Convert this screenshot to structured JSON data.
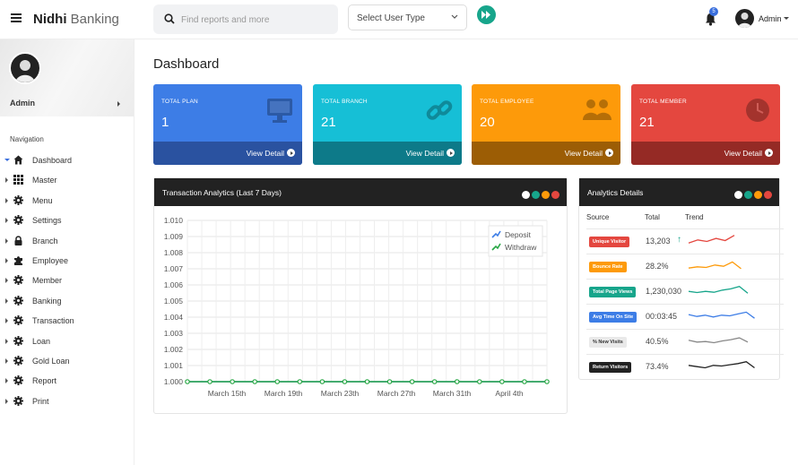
{
  "topbar": {
    "brand_bold": "Nidhi",
    "brand_light": "Banking",
    "search_placeholder": "Find reports and more",
    "user_type_label": "Select User Type",
    "notification_count": "5",
    "username": "Admin"
  },
  "sidebar": {
    "username": "Admin",
    "nav_heading": "Navigation",
    "items": [
      {
        "label": "Dashboard",
        "icon": "home-icon",
        "active": true
      },
      {
        "label": "Master",
        "icon": "grid-icon"
      },
      {
        "label": "Menu",
        "icon": "gear-icon"
      },
      {
        "label": "Settings",
        "icon": "gear-icon"
      },
      {
        "label": "Branch",
        "icon": "lock-icon"
      },
      {
        "label": "Employee",
        "icon": "puzzle-icon"
      },
      {
        "label": "Member",
        "icon": "gear-icon"
      },
      {
        "label": "Banking",
        "icon": "gear-icon"
      },
      {
        "label": "Transaction",
        "icon": "gear-icon"
      },
      {
        "label": "Loan",
        "icon": "gear-icon"
      },
      {
        "label": "Gold Loan",
        "icon": "gear-icon"
      },
      {
        "label": "Report",
        "icon": "gear-icon"
      },
      {
        "label": "Print",
        "icon": "gear-icon"
      }
    ]
  },
  "page_title": "Dashboard",
  "stats": [
    {
      "label": "TOTAL PLAN",
      "value": "1",
      "link": "View Detail",
      "icon": "monitor-icon",
      "color": "#3d7de6",
      "foot_color": "#2a52a0"
    },
    {
      "label": "TOTAL BRANCH",
      "value": "21",
      "link": "View Detail",
      "icon": "link-icon",
      "color": "#16bfd6",
      "foot_color": "#0d7a89"
    },
    {
      "label": "TOTAL EMPLOYEE",
      "value": "20",
      "link": "View Detail",
      "icon": "users-icon",
      "color": "#fd9a0a",
      "foot_color": "#9c5d05"
    },
    {
      "label": "TOTAL MEMBER",
      "value": "21",
      "link": "View Detail",
      "icon": "clock-icon",
      "color": "#e4473f",
      "foot_color": "#952a25"
    }
  ],
  "transaction_panel": {
    "title": "Transaction Analytics (Last 7 Days)"
  },
  "analytics_panel": {
    "title": "Analytics Details",
    "headers": [
      "Source",
      "Total",
      "Trend"
    ],
    "rows": [
      {
        "source": "Unique Visitor",
        "total": "13,203",
        "up": true,
        "color": "#e4473f",
        "text_color": "#ffffff",
        "trend": [
          2,
          3,
          2.5,
          3.5,
          2.8,
          4.5
        ]
      },
      {
        "source": "Bounce Rate",
        "total": "28.2%",
        "color": "#fd9a0a",
        "text_color": "#ffffff",
        "trend": [
          2,
          2.4,
          2.2,
          3,
          2.6,
          4,
          1.8
        ]
      },
      {
        "source": "Total Page Views",
        "total": "1,230,030",
        "color": "#17a58b",
        "text_color": "#ffffff",
        "trend": [
          2.6,
          2.2,
          2.6,
          2.3,
          3,
          3.4,
          4.2,
          2
        ]
      },
      {
        "source": "Avg Time On Site",
        "total": "00:03:45",
        "color": "#3d7de6",
        "text_color": "#ffffff",
        "trend": [
          3.2,
          2.6,
          3,
          2.4,
          3,
          2.8,
          3.4,
          4,
          2
        ]
      },
      {
        "source": "% New Visits",
        "total": "40.5%",
        "color": "#e9e9e9",
        "text_color": "#333333",
        "trend": [
          3,
          2.4,
          2.6,
          2.2,
          2.8,
          3.2,
          3.8,
          2.4
        ]
      },
      {
        "source": "Return Visitors",
        "total": "73.4%",
        "color": "#222222",
        "text_color": "#ffffff",
        "trend": [
          3,
          2.6,
          2.2,
          3,
          2.8,
          3.2,
          3.6,
          4.2,
          2.2
        ]
      }
    ]
  },
  "chart_data": {
    "type": "line",
    "title": "Transaction Analytics (Last 7 Days)",
    "xlabel": "",
    "ylabel": "",
    "x_tick_labels": [
      "March 15th",
      "March 19th",
      "March 23th",
      "March 27th",
      "March 31th",
      "April 4th"
    ],
    "yticks": [
      "1.000",
      "1.001",
      "1.002",
      "1.003",
      "1.004",
      "1.005",
      "1.006",
      "1.007",
      "1.008",
      "1.009",
      "1.010"
    ],
    "ylim": [
      1.0,
      1.01
    ],
    "grid": true,
    "legend_position": "top-right",
    "series": [
      {
        "name": "Deposit",
        "color": "#3d7de6",
        "values": [
          0,
          0,
          0,
          0,
          0,
          0,
          0,
          0,
          0,
          0,
          0,
          0,
          0,
          0,
          0,
          0,
          0,
          0,
          0,
          0,
          0,
          0,
          0,
          0,
          0,
          0,
          0,
          0,
          0,
          0,
          0,
          0,
          0,
          0,
          0,
          0,
          0,
          0,
          0,
          0,
          0,
          0,
          0,
          0,
          0,
          0,
          0,
          0,
          0,
          0,
          0,
          0,
          0,
          0,
          0,
          0,
          0,
          0
        ]
      },
      {
        "name": "Withdraw",
        "color": "#28a745",
        "values": [
          0,
          0,
          0,
          0,
          0,
          0,
          0,
          0,
          0,
          0,
          0,
          0,
          0,
          0,
          0,
          0,
          0,
          0,
          0,
          0,
          0,
          0,
          0,
          0,
          0,
          0,
          0,
          0,
          0,
          0,
          0,
          0,
          0,
          0,
          0,
          0,
          0,
          0,
          0,
          0,
          0,
          0,
          0,
          0,
          0,
          0,
          0,
          0,
          0,
          0,
          0,
          0,
          0,
          0,
          0,
          0,
          0,
          0
        ]
      }
    ],
    "marker_count": 17
  }
}
